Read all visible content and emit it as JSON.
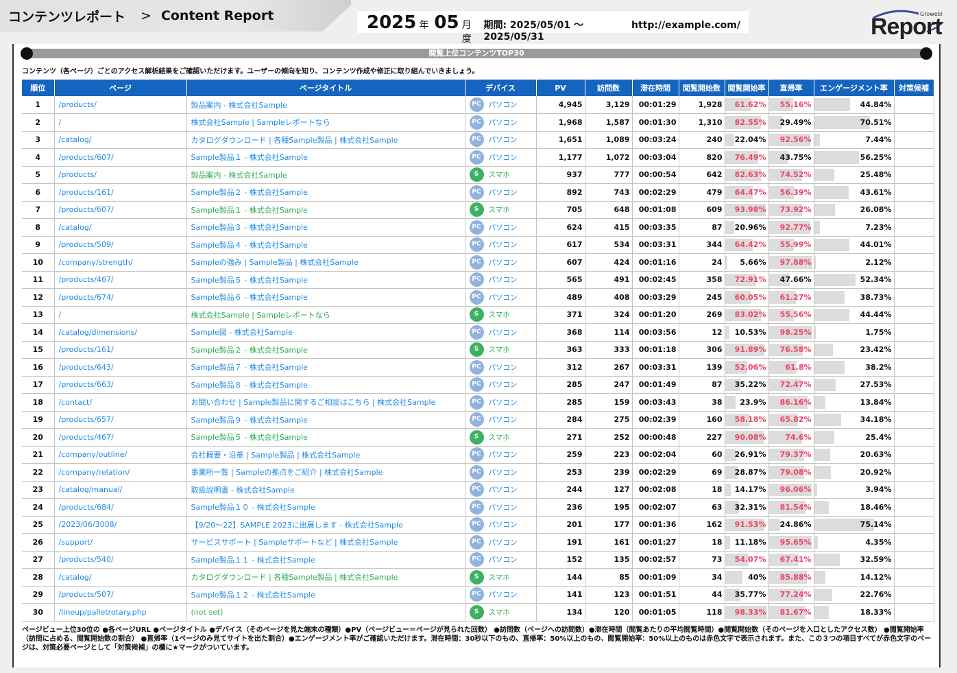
{
  "header": {
    "title_jp": "コンテンツレポート",
    "separator": ">",
    "title_en": "Content Report",
    "year": "2025",
    "year_unit": "年",
    "month": "05",
    "month_unit": "月度",
    "period": "期間: 2025/05/01 〜 2025/05/31",
    "url": "http://example.com/",
    "logo_word": "Report",
    "logo_brand": "Growebl"
  },
  "section": {
    "title": "閲覧上位コンテンツTOP30",
    "intro": "コンテンツ（各ページ）ごとのアクセス解析結果をご確認いただけます。ユーザーの傾向を知り、コンテンツ作成や修正に取り組んでいきましょう。"
  },
  "columns": [
    "順位",
    "ページ",
    "ページタイトル",
    "デバイス",
    "PV",
    "訪問数",
    "滞在時間",
    "閲覧開始数",
    "閲覧開始率",
    "直帰率",
    "エンゲージメント率",
    "対策候補"
  ],
  "device_labels": {
    "pc_badge": "PC",
    "pc_label": "パソコン",
    "sp_badge": "S",
    "sp_label": "スマホ"
  },
  "rows": [
    {
      "rank": "1",
      "url": "/products/",
      "title": "製品案内 - 株式会社Sample",
      "device": "pc",
      "pv": "4,945",
      "visits": "3,129",
      "stay": "00:01:29",
      "starts": "1,928",
      "start_rate": "61.62%",
      "start_pct": 61.62,
      "start_red": true,
      "bounce": "55.16%",
      "bounce_pct": 55.16,
      "bounce_red": true,
      "eng": "44.84%",
      "eng_pct": 44.84,
      "flag": ""
    },
    {
      "rank": "2",
      "url": "/",
      "title": "株式会社Sample | Sampleレポートなら",
      "device": "pc",
      "pv": "1,968",
      "visits": "1,587",
      "stay": "00:01:30",
      "starts": "1,310",
      "start_rate": "82.55%",
      "start_pct": 82.55,
      "start_red": true,
      "bounce": "29.49%",
      "bounce_pct": 29.49,
      "bounce_red": false,
      "eng": "70.51%",
      "eng_pct": 70.51,
      "flag": ""
    },
    {
      "rank": "3",
      "url": "/catalog/",
      "title": "カタログダウンロード | 各種Sample製品 | 株式会社Sample",
      "device": "pc",
      "pv": "1,651",
      "visits": "1,089",
      "stay": "00:03:24",
      "starts": "240",
      "start_rate": "22.04%",
      "start_pct": 22.04,
      "start_red": false,
      "bounce": "92.56%",
      "bounce_pct": 92.56,
      "bounce_red": true,
      "eng": "7.44%",
      "eng_pct": 7.44,
      "flag": ""
    },
    {
      "rank": "4",
      "url": "/products/607/",
      "title": "Sample製品１ - 株式会社Sample",
      "device": "pc",
      "pv": "1,177",
      "visits": "1,072",
      "stay": "00:03:04",
      "starts": "820",
      "start_rate": "76.49%",
      "start_pct": 76.49,
      "start_red": true,
      "bounce": "43.75%",
      "bounce_pct": 43.75,
      "bounce_red": false,
      "eng": "56.25%",
      "eng_pct": 56.25,
      "flag": ""
    },
    {
      "rank": "5",
      "url": "/products/",
      "title": "製品案内 - 株式会社Sample",
      "device": "sp",
      "pv": "937",
      "visits": "777",
      "stay": "00:00:54",
      "starts": "642",
      "start_rate": "82.63%",
      "start_pct": 82.63,
      "start_red": true,
      "bounce": "74.52%",
      "bounce_pct": 74.52,
      "bounce_red": true,
      "eng": "25.48%",
      "eng_pct": 25.48,
      "flag": ""
    },
    {
      "rank": "6",
      "url": "/products/161/",
      "title": "Sample製品２ - 株式会社Sample",
      "device": "pc",
      "pv": "892",
      "visits": "743",
      "stay": "00:02:29",
      "starts": "479",
      "start_rate": "64.47%",
      "start_pct": 64.47,
      "start_red": true,
      "bounce": "56.39%",
      "bounce_pct": 56.39,
      "bounce_red": true,
      "eng": "43.61%",
      "eng_pct": 43.61,
      "flag": ""
    },
    {
      "rank": "7",
      "url": "/products/607/",
      "title": "Sample製品１ - 株式会社Sample",
      "device": "sp",
      "pv": "705",
      "visits": "648",
      "stay": "00:01:08",
      "starts": "609",
      "start_rate": "93.98%",
      "start_pct": 93.98,
      "start_red": true,
      "bounce": "73.92%",
      "bounce_pct": 73.92,
      "bounce_red": true,
      "eng": "26.08%",
      "eng_pct": 26.08,
      "flag": ""
    },
    {
      "rank": "8",
      "url": "/catalog/",
      "title": "Sample製品３ - 株式会社Sample",
      "device": "pc",
      "pv": "624",
      "visits": "415",
      "stay": "00:03:35",
      "starts": "87",
      "start_rate": "20.96%",
      "start_pct": 20.96,
      "start_red": false,
      "bounce": "92.77%",
      "bounce_pct": 92.77,
      "bounce_red": true,
      "eng": "7.23%",
      "eng_pct": 7.23,
      "flag": ""
    },
    {
      "rank": "9",
      "url": "/products/509/",
      "title": "Sample製品４ - 株式会社Sample",
      "device": "pc",
      "pv": "617",
      "visits": "534",
      "stay": "00:03:31",
      "starts": "344",
      "start_rate": "64.42%",
      "start_pct": 64.42,
      "start_red": true,
      "bounce": "55.99%",
      "bounce_pct": 55.99,
      "bounce_red": true,
      "eng": "44.01%",
      "eng_pct": 44.01,
      "flag": ""
    },
    {
      "rank": "10",
      "url": "/company/strength/",
      "title": "Sampleの強み | Sample製品 | 株式会社Sample",
      "device": "pc",
      "pv": "607",
      "visits": "424",
      "stay": "00:01:16",
      "starts": "24",
      "start_rate": "5.66%",
      "start_pct": 5.66,
      "start_red": false,
      "bounce": "97.88%",
      "bounce_pct": 97.88,
      "bounce_red": true,
      "eng": "2.12%",
      "eng_pct": 2.12,
      "flag": ""
    },
    {
      "rank": "11",
      "url": "/products/467/",
      "title": "Sample製品５ - 株式会社Sample",
      "device": "pc",
      "pv": "565",
      "visits": "491",
      "stay": "00:02:45",
      "starts": "358",
      "start_rate": "72.91%",
      "start_pct": 72.91,
      "start_red": true,
      "bounce": "47.66%",
      "bounce_pct": 47.66,
      "bounce_red": false,
      "eng": "52.34%",
      "eng_pct": 52.34,
      "flag": ""
    },
    {
      "rank": "12",
      "url": "/products/674/",
      "title": "Sample製品６ - 株式会社Sample",
      "device": "pc",
      "pv": "489",
      "visits": "408",
      "stay": "00:03:29",
      "starts": "245",
      "start_rate": "60.05%",
      "start_pct": 60.05,
      "start_red": true,
      "bounce": "61.27%",
      "bounce_pct": 61.27,
      "bounce_red": true,
      "eng": "38.73%",
      "eng_pct": 38.73,
      "flag": ""
    },
    {
      "rank": "13",
      "url": "/",
      "title": "株式会社Sample | Sampleレポートなら",
      "device": "sp",
      "pv": "371",
      "visits": "324",
      "stay": "00:01:20",
      "starts": "269",
      "start_rate": "83.02%",
      "start_pct": 83.02,
      "start_red": true,
      "bounce": "55.56%",
      "bounce_pct": 55.56,
      "bounce_red": true,
      "eng": "44.44%",
      "eng_pct": 44.44,
      "flag": ""
    },
    {
      "rank": "14",
      "url": "/catalog/dimensions/",
      "title": "Sample図 - 株式会社Sample",
      "device": "pc",
      "pv": "368",
      "visits": "114",
      "stay": "00:03:56",
      "starts": "12",
      "start_rate": "10.53%",
      "start_pct": 10.53,
      "start_red": false,
      "bounce": "98.25%",
      "bounce_pct": 98.25,
      "bounce_red": true,
      "eng": "1.75%",
      "eng_pct": 1.75,
      "flag": ""
    },
    {
      "rank": "15",
      "url": "/products/161/",
      "title": "Sample製品２ - 株式会社Sample",
      "device": "sp",
      "pv": "363",
      "visits": "333",
      "stay": "00:01:18",
      "starts": "306",
      "start_rate": "91.89%",
      "start_pct": 91.89,
      "start_red": true,
      "bounce": "76.58%",
      "bounce_pct": 76.58,
      "bounce_red": true,
      "eng": "23.42%",
      "eng_pct": 23.42,
      "flag": ""
    },
    {
      "rank": "16",
      "url": "/products/643/",
      "title": "Sample製品７ - 株式会社Sample",
      "device": "pc",
      "pv": "312",
      "visits": "267",
      "stay": "00:03:31",
      "starts": "139",
      "start_rate": "52.06%",
      "start_pct": 52.06,
      "start_red": true,
      "bounce": "61.8%",
      "bounce_pct": 61.8,
      "bounce_red": true,
      "eng": "38.2%",
      "eng_pct": 38.2,
      "flag": ""
    },
    {
      "rank": "17",
      "url": "/products/663/",
      "title": "Sample製品８ - 株式会社Sample",
      "device": "pc",
      "pv": "285",
      "visits": "247",
      "stay": "00:01:49",
      "starts": "87",
      "start_rate": "35.22%",
      "start_pct": 35.22,
      "start_red": false,
      "bounce": "72.47%",
      "bounce_pct": 72.47,
      "bounce_red": true,
      "eng": "27.53%",
      "eng_pct": 27.53,
      "flag": ""
    },
    {
      "rank": "18",
      "url": "/contact/",
      "title": "お問い合わせ | Sample製品に関するご相談はこちら | 株式会社Sample",
      "device": "pc",
      "pv": "285",
      "visits": "159",
      "stay": "00:03:43",
      "starts": "38",
      "start_rate": "23.9%",
      "start_pct": 23.9,
      "start_red": false,
      "bounce": "86.16%",
      "bounce_pct": 86.16,
      "bounce_red": true,
      "eng": "13.84%",
      "eng_pct": 13.84,
      "flag": ""
    },
    {
      "rank": "19",
      "url": "/products/657/",
      "title": "Sample製品９ - 株式会社Sample",
      "device": "pc",
      "pv": "284",
      "visits": "275",
      "stay": "00:02:39",
      "starts": "160",
      "start_rate": "58.18%",
      "start_pct": 58.18,
      "start_red": true,
      "bounce": "65.82%",
      "bounce_pct": 65.82,
      "bounce_red": true,
      "eng": "34.18%",
      "eng_pct": 34.18,
      "flag": ""
    },
    {
      "rank": "20",
      "url": "/products/467/",
      "title": "Sample製品５ - 株式会社Sample",
      "device": "sp",
      "pv": "271",
      "visits": "252",
      "stay": "00:00:48",
      "starts": "227",
      "start_rate": "90.08%",
      "start_pct": 90.08,
      "start_red": true,
      "bounce": "74.6%",
      "bounce_pct": 74.6,
      "bounce_red": true,
      "eng": "25.4%",
      "eng_pct": 25.4,
      "flag": ""
    },
    {
      "rank": "21",
      "url": "/company/outline/",
      "title": "会社概要・沿革 | Sample製品 | 株式会社Sample",
      "device": "pc",
      "pv": "259",
      "visits": "223",
      "stay": "00:02:04",
      "starts": "60",
      "start_rate": "26.91%",
      "start_pct": 26.91,
      "start_red": false,
      "bounce": "79.37%",
      "bounce_pct": 79.37,
      "bounce_red": true,
      "eng": "20.63%",
      "eng_pct": 20.63,
      "flag": ""
    },
    {
      "rank": "22",
      "url": "/company/relation/",
      "title": "事業所一覧 | Sampleの拠点をご紹介 | 株式会社Sample",
      "device": "pc",
      "pv": "253",
      "visits": "239",
      "stay": "00:02:29",
      "starts": "69",
      "start_rate": "28.87%",
      "start_pct": 28.87,
      "start_red": false,
      "bounce": "79.08%",
      "bounce_pct": 79.08,
      "bounce_red": true,
      "eng": "20.92%",
      "eng_pct": 20.92,
      "flag": ""
    },
    {
      "rank": "23",
      "url": "/catalog/manual/",
      "title": "取扱説明書 - 株式会社Sample",
      "device": "pc",
      "pv": "244",
      "visits": "127",
      "stay": "00:02:08",
      "starts": "18",
      "start_rate": "14.17%",
      "start_pct": 14.17,
      "start_red": false,
      "bounce": "96.06%",
      "bounce_pct": 96.06,
      "bounce_red": true,
      "eng": "3.94%",
      "eng_pct": 3.94,
      "flag": ""
    },
    {
      "rank": "24",
      "url": "/products/684/",
      "title": "Sample製品１０ - 株式会社Sample",
      "device": "pc",
      "pv": "236",
      "visits": "195",
      "stay": "00:02:07",
      "starts": "63",
      "start_rate": "32.31%",
      "start_pct": 32.31,
      "start_red": false,
      "bounce": "81.54%",
      "bounce_pct": 81.54,
      "bounce_red": true,
      "eng": "18.46%",
      "eng_pct": 18.46,
      "flag": ""
    },
    {
      "rank": "25",
      "url": "/2023/06/3008/",
      "title": "【9/20〜22】SAMPLE 2023に出展します - 株式会社Sample",
      "device": "pc",
      "pv": "201",
      "visits": "177",
      "stay": "00:01:36",
      "starts": "162",
      "start_rate": "91.53%",
      "start_pct": 91.53,
      "start_red": true,
      "bounce": "24.86%",
      "bounce_pct": 24.86,
      "bounce_red": false,
      "eng": "75.14%",
      "eng_pct": 75.14,
      "flag": ""
    },
    {
      "rank": "26",
      "url": "/support/",
      "title": "サービスサポート | Sampleサポートなど | 株式会社Sample",
      "device": "pc",
      "pv": "191",
      "visits": "161",
      "stay": "00:01:27",
      "starts": "18",
      "start_rate": "11.18%",
      "start_pct": 11.18,
      "start_red": false,
      "bounce": "95.65%",
      "bounce_pct": 95.65,
      "bounce_red": true,
      "eng": "4.35%",
      "eng_pct": 4.35,
      "flag": ""
    },
    {
      "rank": "27",
      "url": "/products/540/",
      "title": "Sample製品１１ - 株式会社Sample",
      "device": "pc",
      "pv": "152",
      "visits": "135",
      "stay": "00:02:57",
      "starts": "73",
      "start_rate": "54.07%",
      "start_pct": 54.07,
      "start_red": true,
      "bounce": "67.41%",
      "bounce_pct": 67.41,
      "bounce_red": true,
      "eng": "32.59%",
      "eng_pct": 32.59,
      "flag": ""
    },
    {
      "rank": "28",
      "url": "/catalog/",
      "title": "カタログダウンロード | 各種Sample製品 | 株式会社Sample",
      "device": "sp",
      "pv": "144",
      "visits": "85",
      "stay": "00:01:09",
      "starts": "34",
      "start_rate": "40%",
      "start_pct": 40,
      "start_red": false,
      "bounce": "85.88%",
      "bounce_pct": 85.88,
      "bounce_red": true,
      "eng": "14.12%",
      "eng_pct": 14.12,
      "flag": ""
    },
    {
      "rank": "29",
      "url": "/products/507/",
      "title": "Sample製品１２ - 株式会社Sample",
      "device": "pc",
      "pv": "141",
      "visits": "123",
      "stay": "00:01:51",
      "starts": "44",
      "start_rate": "35.77%",
      "start_pct": 35.77,
      "start_red": false,
      "bounce": "77.24%",
      "bounce_pct": 77.24,
      "bounce_red": true,
      "eng": "22.76%",
      "eng_pct": 22.76,
      "flag": ""
    },
    {
      "rank": "30",
      "url": "/lineup/palletrotary.php",
      "title": "(not set)",
      "device": "sp",
      "pv": "134",
      "visits": "120",
      "stay": "00:01:05",
      "starts": "118",
      "start_rate": "98.33%",
      "start_pct": 98.33,
      "start_red": true,
      "bounce": "81.67%",
      "bounce_pct": 81.67,
      "bounce_red": true,
      "eng": "18.33%",
      "eng_pct": 18.33,
      "flag": ""
    }
  ],
  "footnote": "ページビュー上位30位の ●各ページURL ●ページタイトル ●デバイス（そのページを見た端末の種類）●PV（ページビュー＝ページが見られた回数） ●訪問数（ページへの訪問数）●滞在時間（閲覧あたりの平均閲覧時間）●閲覧開始数（そのページを入口としたアクセス数） ●閲覧開始率（訪問に占める、閲覧開始数の割合） ●直帰率（1ページのみ見てサイトを出た割合）●エンゲージメント率がご確認いただけます。滞在時間：30秒以下のもの、直帰率：50%以上のもの、閲覧開始率：50%以上のものは赤色文字で表示されます。また、この３つの項目すべてが赤色文字のページは、対策必要ページとして「対策候補」の欄に★マークがついています。",
  "colors": {
    "header_blue": "#1565c0",
    "link_blue": "#1e88e5",
    "sp_green": "#2eaa55",
    "alert_red": "#ee4466",
    "bar_gray": "#dcdcdc"
  }
}
